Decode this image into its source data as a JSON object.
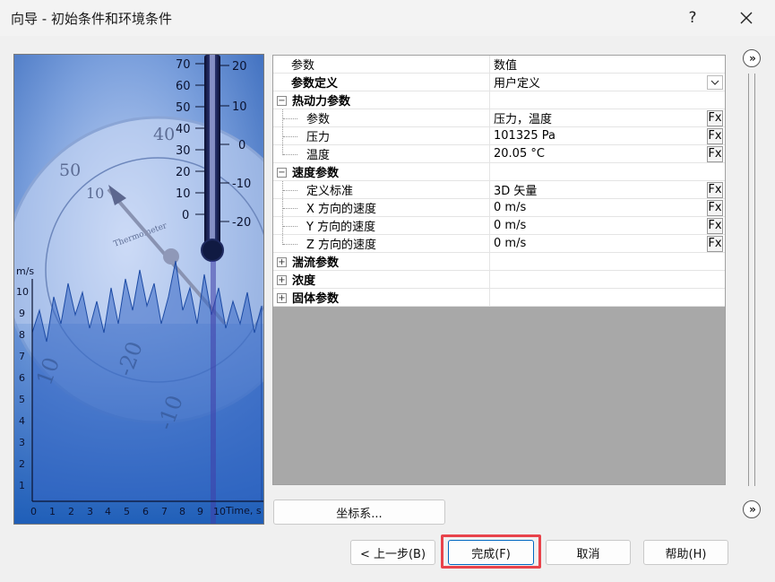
{
  "window": {
    "title": "向导 - 初始条件和环境条件",
    "help_glyph": "?",
    "close_icon": "close-icon"
  },
  "illustration": {
    "thermometer_celsius_ticks": [
      "70",
      "60",
      "50",
      "40",
      "30",
      "20",
      "10",
      "0"
    ],
    "thermometer_right_ticks": [
      "20",
      "10",
      "0",
      "-10",
      "-20"
    ],
    "dial_numbers": [
      "50",
      "40",
      "10"
    ],
    "dial_brand": "Thermometer",
    "chart_ylabel": "m/s",
    "chart_y_ticks": [
      "10",
      "9",
      "8",
      "7",
      "6",
      "5",
      "4",
      "3",
      "2",
      "1"
    ],
    "chart_x_ticks": [
      "0",
      "1",
      "2",
      "3",
      "4",
      "5",
      "6",
      "7",
      "8",
      "9",
      "10"
    ],
    "chart_xlabel": "Time, s",
    "chart_bg_numbers": [
      "-20",
      "-10",
      "10"
    ]
  },
  "grid": {
    "header": {
      "col1": "参数",
      "col2": "数值"
    },
    "definition": {
      "label": "参数定义",
      "value": "用户定义"
    },
    "groups": {
      "thermo": {
        "label": "热动力参数",
        "rows": [
          {
            "label": "参数",
            "value": "压力，温度"
          },
          {
            "label": "压力",
            "value": "101325 Pa"
          },
          {
            "label": "温度",
            "value": "20.05 °C"
          }
        ]
      },
      "velocity": {
        "label": "速度参数",
        "rows": [
          {
            "label": "定义标准",
            "value": "3D 矢量"
          },
          {
            "label": "X 方向的速度",
            "value": "0 m/s"
          },
          {
            "label": "Y 方向的速度",
            "value": "0 m/s"
          },
          {
            "label": "Z 方向的速度",
            "value": "0 m/s"
          }
        ]
      },
      "turbulence": {
        "label": "湍流参数"
      },
      "concentration": {
        "label": "浓度"
      },
      "solid": {
        "label": "固体参数"
      }
    },
    "fx_label": "Fx",
    "expand_glyph": "+",
    "collapse_glyph": "−"
  },
  "side": {
    "expand_glyph": "»"
  },
  "buttons": {
    "coordinate_system": "坐标系...",
    "back": "< 上一步(B)",
    "finish": "完成(F)",
    "cancel": "取消",
    "help": "帮助(H)"
  },
  "colors": {
    "highlight": "#e8434b",
    "accent": "#0067c0",
    "grid_empty": "#a8a8a8"
  }
}
